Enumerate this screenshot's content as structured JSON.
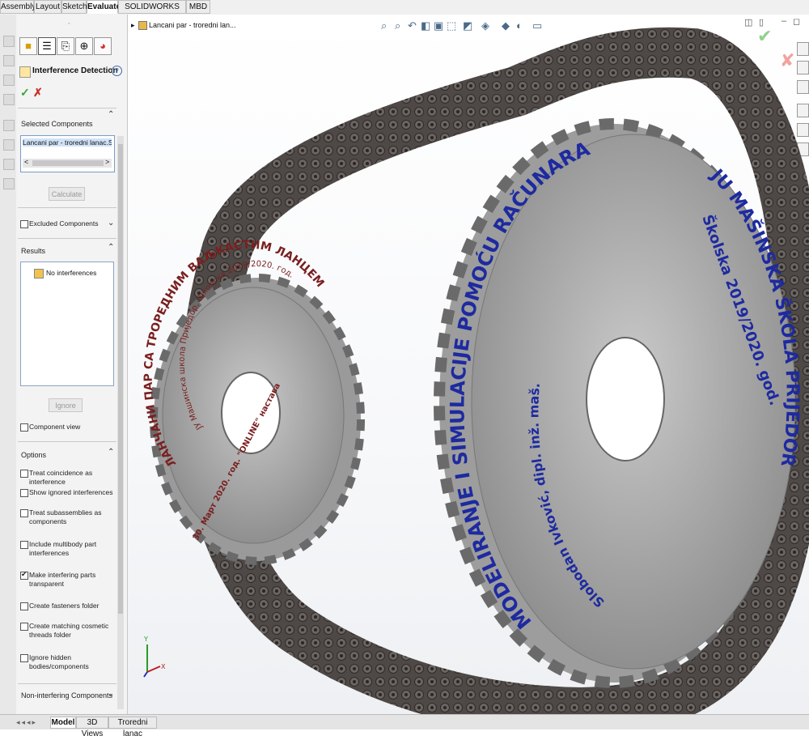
{
  "command_tabs": [
    "Assembly",
    "Layout",
    "Sketch",
    "Evaluate",
    "SOLIDWORKS Add-Ins",
    "MBD"
  ],
  "active_tab": "Evaluate",
  "panel": {
    "title": "Interference Detection",
    "help": "?",
    "ok": "✓",
    "cancel": "✗",
    "selected_components": {
      "label": "Selected Components",
      "value": "Lancani par - troredni lanac.SLDASM",
      "scroll_left": "<",
      "scroll_right": ">"
    },
    "calculate_label": "Calculate",
    "excluded_label": "Excluded Components",
    "results_label": "Results",
    "results_item": "No interferences",
    "ignore_label": "Ignore",
    "component_view_label": "Component view",
    "options_label": "Options",
    "options": [
      {
        "label": "Treat coincidence as interference",
        "checked": false
      },
      {
        "label": "Show ignored interferences",
        "checked": false
      },
      {
        "label": "Treat subassemblies as components",
        "checked": false
      },
      {
        "label": "Include multibody part interferences",
        "checked": false
      },
      {
        "label": "Make interfering parts transparent",
        "checked": true
      },
      {
        "label": "Create fasteners folder",
        "checked": false
      },
      {
        "label": "Create matching cosmetic threads folder",
        "checked": false
      },
      {
        "label": "Ignore hidden bodies/components",
        "checked": false
      }
    ],
    "non_interfering_label": "Non-interfering Components"
  },
  "tree_item": "Lancani par - troredni lan...",
  "bottom_tabs": [
    "Model",
    "3D Views",
    "Troredni lanac"
  ],
  "active_bottom_tab": "Model",
  "sprocket_small": {
    "outer_text": "ЛАНЧАНИ ПАР СА ТРОРЕДНИМ ВАЉКАСТИМ ЛАНЦЕМ",
    "inner_text_1": "ЈУ Машинска школа Приједор, Школска 2019/2020. год.",
    "inner_text_2": "30. Март 2020. год. \"ONLINE\" настава",
    "text_color": "#7a1f1f"
  },
  "sprocket_large": {
    "outer_text": "MODELIRANJE I SIMULACIJE POMOĆU RAČUNARA",
    "top_text": "JU MAŠINSKA ŠKOLA PRIJEDOR",
    "mid_text": "Školska 2019/2020. god.",
    "inner_text": "Slobodan Ivković, dipl. inž. maš.",
    "text_color": "#1d2aa0"
  },
  "colors": {
    "chain": "#4a4542",
    "sprocket": "#b8b8b8",
    "accent_ok": "#3aa53a",
    "accent_cancel": "#c8312b"
  },
  "axes": {
    "x": "X",
    "y": "Y"
  }
}
